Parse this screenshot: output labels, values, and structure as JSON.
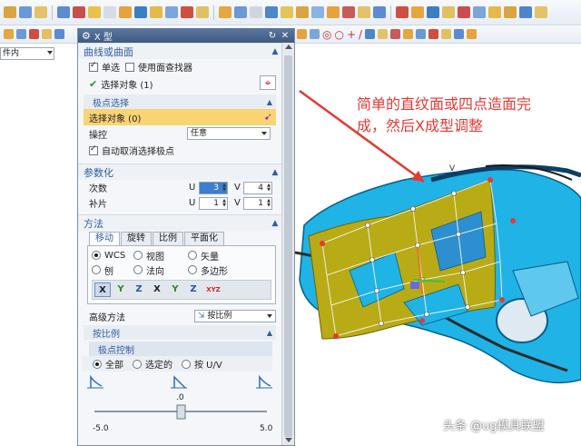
{
  "toolbar": {
    "filter_label": "件内"
  },
  "dialog": {
    "title": "X 型",
    "curve_section": {
      "header": "曲线或曲面",
      "single_select": "单选",
      "use_face_finder": "使用面查找器",
      "select_object": "选择对象 (1)"
    },
    "pole_section": {
      "header": "极点选择",
      "select_object": "选择对象 (0)",
      "manipulate_label": "操控",
      "manipulate_value": "任意",
      "auto_deselect": "自动取消选择极点"
    },
    "param_section": {
      "header": "参数化",
      "degree_label": "次数",
      "patch_label": "补片",
      "u": "U",
      "v": "V",
      "degree_u": "3",
      "degree_v": "4",
      "patch_u": "1",
      "patch_v": "1"
    },
    "method_section": {
      "header": "方法",
      "tabs": [
        "移动",
        "旋转",
        "比例",
        "平面化"
      ],
      "radios": [
        "WCS",
        "视图",
        "矢量",
        "刨",
        "法向",
        "多边形"
      ],
      "axes": [
        "X",
        "Y",
        "Z",
        "X",
        "Y",
        "Z",
        "XYZ"
      ],
      "advanced_label": "高级方法",
      "advanced_value": "按比例",
      "by_ratio_header": "按比例",
      "pole_control_header": "极点控制",
      "control_radios": [
        "全部",
        "选定的",
        "按 U/V"
      ],
      "slider_value": ".0",
      "slider_min": "-5.0",
      "slider_max": "5.0"
    }
  },
  "annotation": {
    "line1": "简单的直纹面或四点造面完",
    "line2": "成，然后X成型调整",
    "color": "#e53935"
  },
  "watermark": "头条 @ug模具联盟"
}
